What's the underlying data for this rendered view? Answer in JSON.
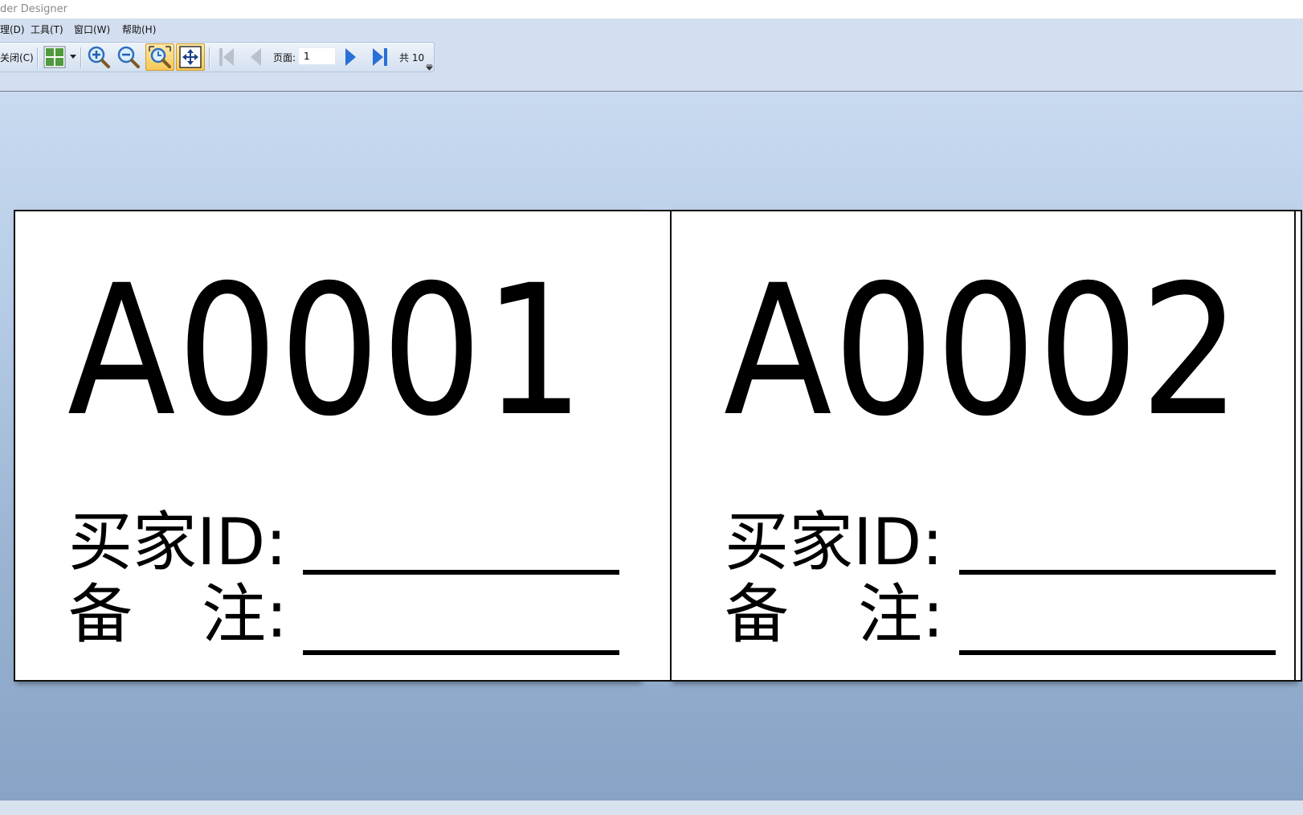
{
  "window": {
    "title": "der Designer"
  },
  "menu": {
    "items": [
      {
        "label": "理(D)"
      },
      {
        "label": "工具(T)"
      },
      {
        "label": "窗口(W)"
      },
      {
        "label": "帮助(H)"
      }
    ]
  },
  "toolbar": {
    "close_label": "关闭(C)",
    "page_label": "页面:",
    "page_value": "1",
    "total_label": "共 10",
    "icons": [
      "layout-grid-icon",
      "zoom-in-icon",
      "zoom-out-icon",
      "zoom-page-icon",
      "fit-window-icon",
      "first-page-icon",
      "previous-page-icon",
      "next-page-icon",
      "last-page-icon"
    ]
  },
  "labels": [
    {
      "code": "A0001",
      "buyer_label": "买家ID:",
      "remark_label_1": "备",
      "remark_label_2": "注:"
    },
    {
      "code": "A0002",
      "buyer_label": "买家ID:",
      "remark_label_1": "备",
      "remark_label_2": "注:"
    }
  ],
  "colors": {
    "accent": "#f7c857",
    "workspace_top": "#c9daf0",
    "workspace_bottom": "#87a3c5",
    "nav_blue": "#2a6fd6"
  }
}
